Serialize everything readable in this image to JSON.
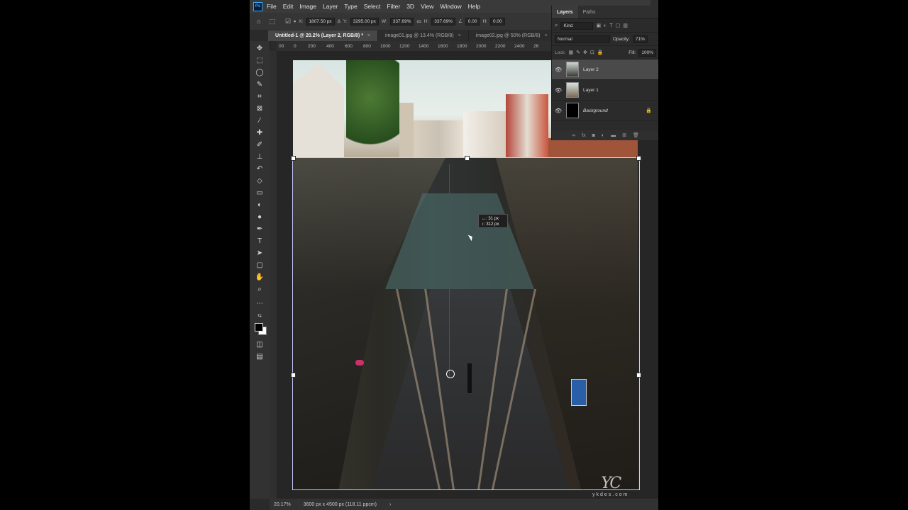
{
  "menu": [
    "File",
    "Edit",
    "Image",
    "Layer",
    "Type",
    "Select",
    "Filter",
    "3D",
    "View",
    "Window",
    "Help"
  ],
  "options_bar": {
    "x_label": "X:",
    "x_value": "1807.50 px",
    "y_label": "Y:",
    "y_value": "3295.00 px",
    "w_label": "W:",
    "w_value": "337.69%",
    "h_label": "H:",
    "h_value": "337.69%",
    "angle_value": "0.00",
    "h_skew_label": "H:",
    "h_skew_value": "0.00"
  },
  "tabs": [
    {
      "label": "Untitled-1 @ 20.2% (Layer 2, RGB/8) *",
      "active": true
    },
    {
      "label": "image01.jpg @ 13.4% (RGB/8)",
      "active": false
    },
    {
      "label": "image02.jpg @ 50% (RGB/8)",
      "active": false
    }
  ],
  "ruler_ticks": [
    "00",
    "0",
    "200",
    "400",
    "600",
    "800",
    "1000",
    "1200",
    "1400",
    "1600",
    "1800",
    "2000",
    "2200",
    "2400",
    "26"
  ],
  "transform_tooltip": {
    "line1": "↔: 31 px",
    "line2": "↕: 312 px"
  },
  "status": {
    "zoom": "20.17%",
    "doc_info": "3600 px x 4500 px (118.11 ppcm)",
    "arrow": "›"
  },
  "layers_panel": {
    "tab_layers": "Layers",
    "tab_paths": "Paths",
    "filter_placeholder": "Kind",
    "blend_mode": "Normal",
    "opacity_label": "Opacity:",
    "opacity_value": "71%",
    "lock_label": "Lock:",
    "fill_label": "Fill:",
    "fill_value": "100%",
    "layers": [
      {
        "name": "Layer 2",
        "selected": true
      },
      {
        "name": "Layer 1",
        "selected": false
      },
      {
        "name": "Background",
        "selected": false
      }
    ]
  },
  "watermark": {
    "logo": "YC",
    "text": "ykdes.com"
  },
  "icons": [
    "home-icon",
    "move-icon",
    "marquee-icon",
    "lasso-icon",
    "quick-select-icon",
    "crop-icon",
    "frame-icon",
    "eyedropper-icon",
    "healing-icon",
    "brush-icon",
    "stamp-icon",
    "history-brush-icon",
    "eraser-icon",
    "gradient-icon",
    "blur-icon",
    "dodge-icon",
    "pen-icon",
    "type-icon",
    "path-select-icon",
    "shape-icon",
    "hand-icon",
    "zoom-icon",
    "more-icon",
    "eye-icon",
    "lock-icon"
  ],
  "colors": {
    "guide": "#c000c0",
    "accent": "#31a8ff",
    "selected_layer": "#4a4a4a"
  }
}
